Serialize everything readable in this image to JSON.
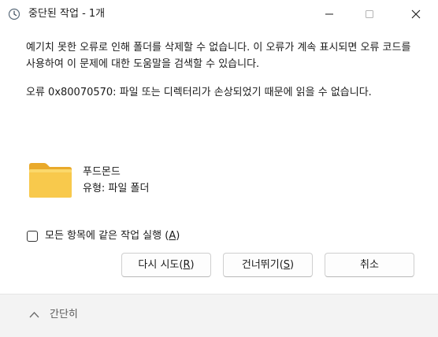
{
  "window": {
    "title": "중단된 작업 - 1개"
  },
  "message": {
    "line1": "예기치 못한 오류로 인해 폴더를 삭제할 수 없습니다. 이 오류가 계속 표시되면 오류 코드를 사용하여 이 문제에 대한 도움말을 검색할 수 있습니다.",
    "line2": "오류 0x80070570: 파일 또는 디렉터리가 손상되었기 때문에 읽을 수 없습니다."
  },
  "item": {
    "name": "푸드몬드",
    "type": "유형: 파일 폴더"
  },
  "apply_all": {
    "label": "모든 항목에 같은 작업 실행",
    "accel_open": "(",
    "accel_key": "A",
    "accel_close": ")",
    "checked": false
  },
  "buttons": {
    "retry": {
      "label": "다시 시도",
      "accel_open": "(",
      "accel_key": "R",
      "accel_close": ")"
    },
    "skip": {
      "label": "건너뛰기",
      "accel_open": "(",
      "accel_key": "S",
      "accel_close": ")"
    },
    "cancel": {
      "label": "취소"
    }
  },
  "footer": {
    "toggle_label": "간단히"
  },
  "icons": {
    "title": "clock-icon",
    "minimize": "minimize-icon",
    "maximize": "maximize-icon",
    "close": "close-icon",
    "folder": "folder-icon",
    "collapse": "chevron-up-icon"
  },
  "colors": {
    "folder_front": "#F8C94C",
    "folder_back": "#E9A92A",
    "footer_bg": "#F3F3F3",
    "button_border": "#CFCFCF"
  }
}
